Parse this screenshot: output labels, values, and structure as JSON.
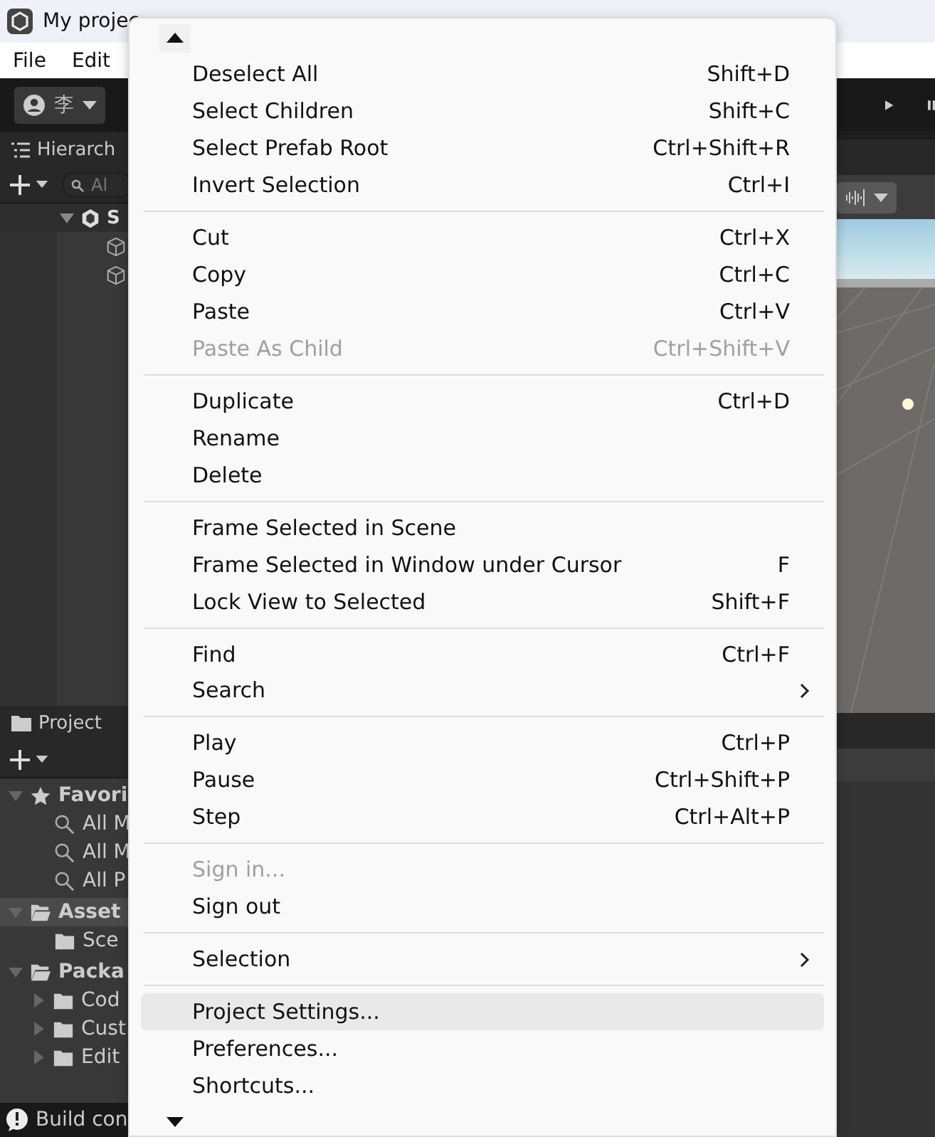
{
  "window": {
    "title": "My projec"
  },
  "menubar": [
    "File",
    "Edit"
  ],
  "toolbar": {
    "account": "李"
  },
  "hierarchy": {
    "title": "Hierarch",
    "search_placeholder": "Al",
    "tree": [
      {
        "label": "S",
        "expanded": true,
        "children": [
          {
            "kind": "object"
          },
          {
            "kind": "object"
          }
        ]
      }
    ]
  },
  "project": {
    "title": "Project",
    "tree": [
      {
        "label": "Favori",
        "kind": "favorites",
        "expanded": true,
        "selected": false,
        "children": [
          {
            "label": "All M",
            "kind": "search"
          },
          {
            "label": "All M",
            "kind": "search"
          },
          {
            "label": "All P",
            "kind": "search"
          }
        ]
      },
      {
        "label": "Asset",
        "kind": "folder",
        "expanded": true,
        "selected": true,
        "children": [
          {
            "label": "Sce",
            "kind": "folder"
          }
        ]
      },
      {
        "label": "Packa",
        "kind": "folder",
        "expanded": true,
        "selected": false,
        "children": [
          {
            "label": "Cod",
            "kind": "folder",
            "expanded": false
          },
          {
            "label": "Cust",
            "kind": "folder",
            "expanded": false
          },
          {
            "label": "Edit",
            "kind": "folder",
            "expanded": false
          }
        ]
      }
    ]
  },
  "status_bar": {
    "text": "Build con"
  },
  "context_menu": {
    "groups": [
      [
        {
          "label": "Deselect All",
          "shortcut": "Shift+D",
          "disabled": false,
          "selected": false
        },
        {
          "label": "Select Children",
          "shortcut": "Shift+C",
          "disabled": false,
          "selected": false
        },
        {
          "label": "Select Prefab Root",
          "shortcut": "Ctrl+Shift+R",
          "disabled": false,
          "selected": false
        },
        {
          "label": "Invert Selection",
          "shortcut": "Ctrl+I",
          "disabled": false,
          "selected": false
        }
      ],
      [
        {
          "label": "Cut",
          "shortcut": "Ctrl+X",
          "disabled": false,
          "selected": false
        },
        {
          "label": "Copy",
          "shortcut": "Ctrl+C",
          "disabled": false,
          "selected": false
        },
        {
          "label": "Paste",
          "shortcut": "Ctrl+V",
          "disabled": false,
          "selected": false
        },
        {
          "label": "Paste As Child",
          "shortcut": "Ctrl+Shift+V",
          "disabled": true,
          "selected": false
        }
      ],
      [
        {
          "label": "Duplicate",
          "shortcut": "Ctrl+D",
          "disabled": false,
          "selected": false
        },
        {
          "label": "Rename",
          "disabled": false,
          "selected": false
        },
        {
          "label": "Delete",
          "disabled": false,
          "selected": false
        }
      ],
      [
        {
          "label": "Frame Selected in Scene",
          "disabled": false,
          "selected": false
        },
        {
          "label": "Frame Selected in Window under Cursor",
          "shortcut": "F",
          "disabled": false,
          "selected": false
        },
        {
          "label": "Lock View to Selected",
          "shortcut": "Shift+F",
          "disabled": false,
          "selected": false
        }
      ],
      [
        {
          "label": "Find",
          "shortcut": "Ctrl+F",
          "disabled": false,
          "selected": false
        },
        {
          "label": "Search",
          "submenu": true,
          "disabled": false,
          "selected": false
        }
      ],
      [
        {
          "label": "Play",
          "shortcut": "Ctrl+P",
          "disabled": false,
          "selected": false
        },
        {
          "label": "Pause",
          "shortcut": "Ctrl+Shift+P",
          "disabled": false,
          "selected": false
        },
        {
          "label": "Step",
          "shortcut": "Ctrl+Alt+P",
          "disabled": false,
          "selected": false
        }
      ],
      [
        {
          "label": "Sign in...",
          "disabled": true,
          "selected": false
        },
        {
          "label": "Sign out",
          "disabled": false,
          "selected": false
        }
      ],
      [
        {
          "label": "Selection",
          "submenu": true,
          "disabled": false,
          "selected": false
        }
      ],
      [
        {
          "label": "Project Settings...",
          "disabled": false,
          "selected": true
        },
        {
          "label": "Preferences...",
          "disabled": false,
          "selected": false
        },
        {
          "label": "Shortcuts...",
          "disabled": false,
          "selected": false
        }
      ]
    ]
  }
}
